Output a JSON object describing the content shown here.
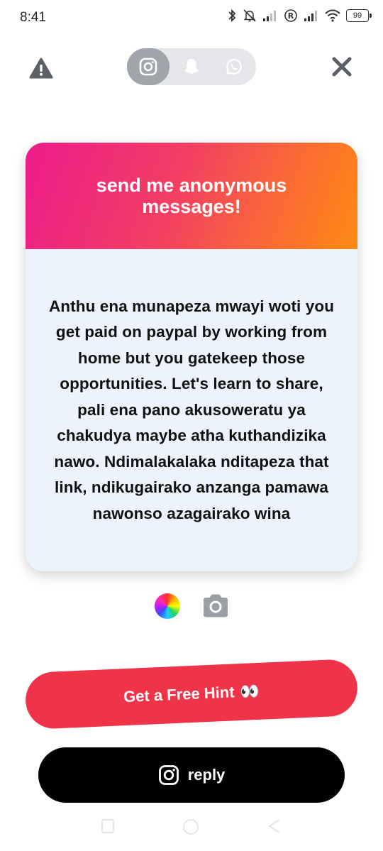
{
  "status_bar": {
    "time": "8:41",
    "battery": "99"
  },
  "platforms": [
    {
      "name": "instagram",
      "icon": "instagram-icon",
      "active": true
    },
    {
      "name": "snapchat",
      "icon": "snapchat-icon",
      "active": false
    },
    {
      "name": "whatsapp",
      "icon": "whatsapp-icon",
      "active": false
    }
  ],
  "card": {
    "title": "send me anonymous messages!",
    "message": "Anthu ena munapeza mwayi woti you get paid on paypal by working from home but you gatekeep those opportunities. Let's learn to share, pali ena pano akusoweratu ya chakudya maybe atha kuthandizika nawo. Ndimalakalaka nditapeza that link, ndikugairako anzanga pamawa nawonso azagairako wina",
    "gradient_start": "#ec1c8b",
    "gradient_end": "#ff8a12",
    "body_color": "#edf3fc"
  },
  "buttons": {
    "hint_label": "Get a Free Hint",
    "hint_emoji": "👀",
    "reply_label": "reply",
    "hint_color": "#ef3349",
    "reply_color": "#000000"
  },
  "icons": {
    "warning": "warning-icon",
    "close": "close-icon",
    "color_picker": "color-wheel-icon",
    "camera": "camera-icon"
  }
}
